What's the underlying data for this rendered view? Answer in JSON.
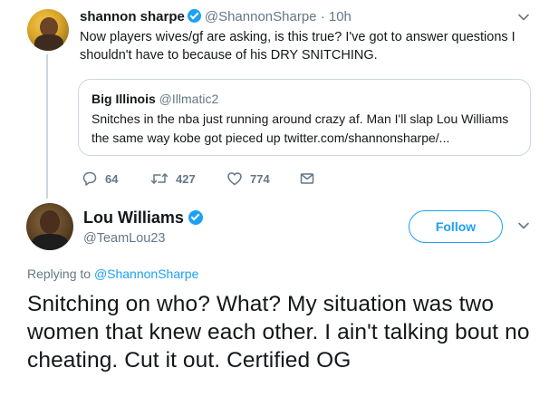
{
  "parent_tweet": {
    "name": "shannon sharpe",
    "handle": "@ShannonSharpe",
    "separator": "·",
    "time": "10h",
    "text": "Now players wives/gf are asking, is this true? I've got to answer questions I shouldn't have to because of his DRY SNITCHING.",
    "quoted": {
      "name": "Big Illinois",
      "handle": "@Illmatic2",
      "text": "Snitches in the nba just running around crazy af. Man I'll slap Lou Williams the same way kobe got pieced up twitter.com/shannonsharpe/..."
    },
    "actions": {
      "replies": "64",
      "retweets": "427",
      "likes": "774"
    }
  },
  "main_tweet": {
    "name": "Lou Williams",
    "handle": "@TeamLou23",
    "follow_label": "Follow",
    "replying_prefix": "Replying to",
    "replying_to": "@ShannonSharpe",
    "text": "Snitching on who? What? My situation was two women that knew each other. I ain't talking bout no cheating. Cut it out. Certified OG"
  },
  "colors": {
    "accent": "#1da1f2",
    "muted": "#657786",
    "text": "#14171a",
    "border": "#ccd6dd"
  },
  "icons": {
    "reply": "reply-icon",
    "retweet": "retweet-icon",
    "like": "heart-icon",
    "dm": "envelope-icon",
    "verified": "verified-badge-icon",
    "menu": "chevron-down-icon"
  }
}
